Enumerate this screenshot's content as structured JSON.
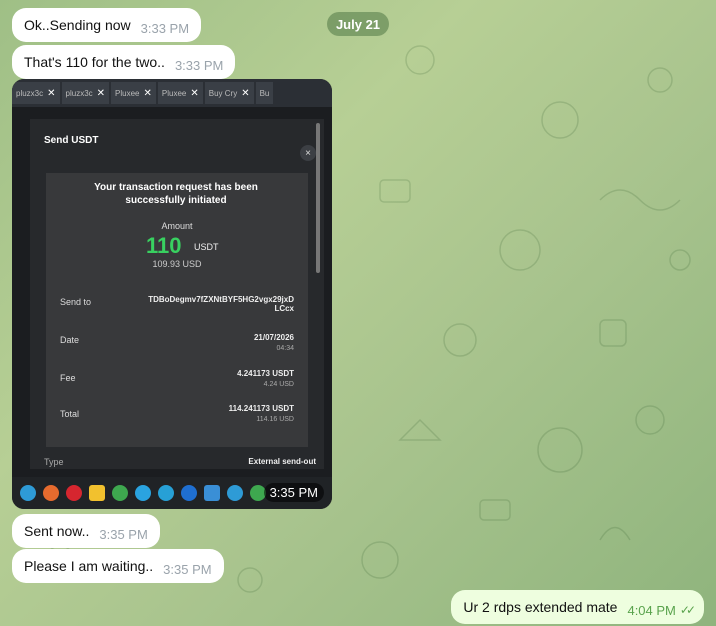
{
  "date_separator": "July 21",
  "messages": [
    {
      "text": "Ok..Sending now",
      "time": "3:33 PM"
    },
    {
      "text": "That's 110 for the two..",
      "time": "3:33 PM"
    },
    {
      "text": "Sent now..",
      "time": "3:35 PM"
    },
    {
      "text": "Please I am waiting..",
      "time": "3:35 PM"
    }
  ],
  "photo": {
    "time": "3:35 PM",
    "tabs": [
      "pluzx3c",
      "pluzx3c",
      "Pluxee",
      "Pluxee",
      "Buy Cry",
      "Bu"
    ],
    "dialog": {
      "title": "Send USDT",
      "close": "×",
      "status": "Your transaction request has been successfully initiated",
      "amount_label": "Amount",
      "amount": "110",
      "currency": "USDT",
      "usd_value": "109.93 USD",
      "send_to_label": "Send to",
      "send_to_value": "TDBoDegmv7fZXNtBYF5HG2vgx29jxD LCcx",
      "date_label": "Date",
      "date_value": "21/07/2026",
      "date_time": "04:34",
      "fee_label": "Fee",
      "fee_value": "4.241173 USDT",
      "fee_usd": "4.24 USD",
      "total_label": "Total",
      "total_value": "114.241173 USDT",
      "total_usd": "114.16 USD",
      "type_label": "Type",
      "type_value": "External send-out"
    }
  },
  "outgoing": {
    "text": "Ur 2 rdps extended mate",
    "time": "4:04 PM",
    "status_icon": "double-check-icon"
  },
  "colors": {
    "outgoing_bubble": "#eefedf",
    "incoming_bubble": "#ffffff",
    "amount_green": "#38d160"
  }
}
